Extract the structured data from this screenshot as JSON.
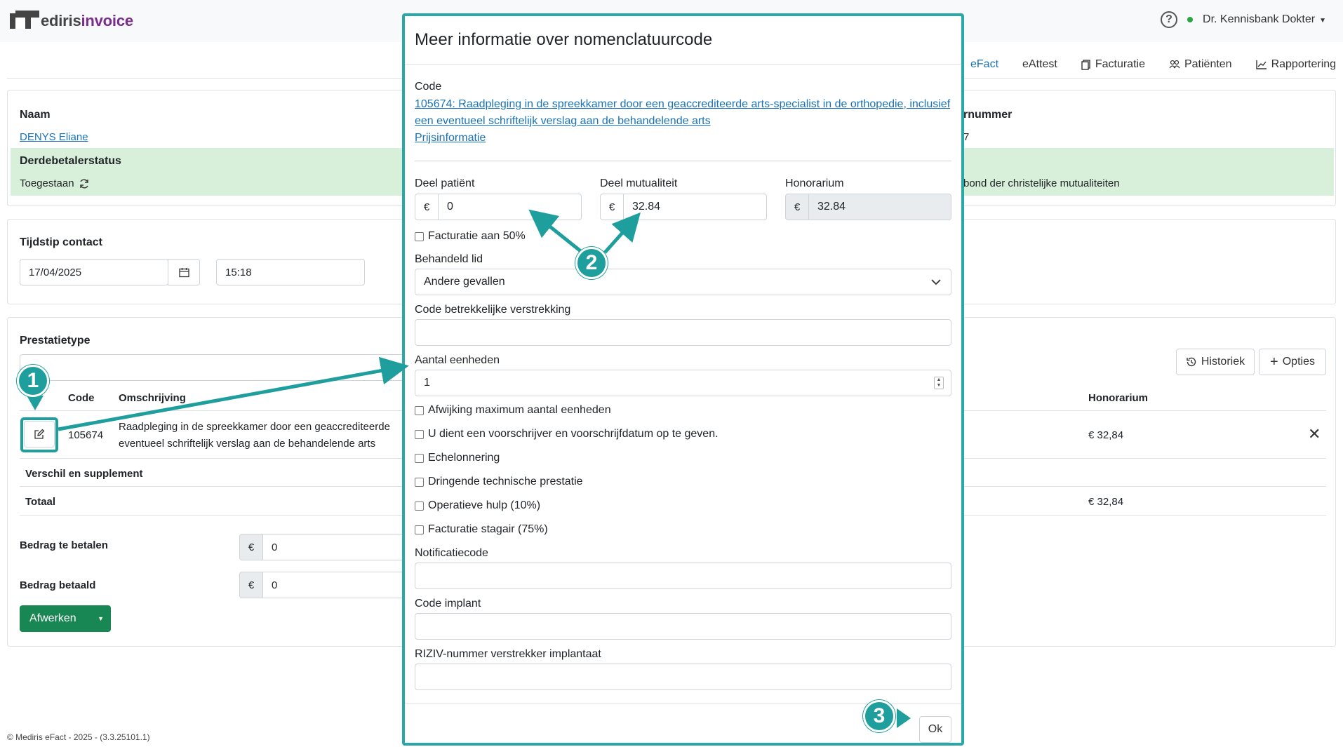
{
  "app": {
    "logo_prefix": "m",
    "logo_main": "ediris",
    "logo_accent": "invoice",
    "user": "Dr. Kennisbank Dokter"
  },
  "nav": {
    "tabs": [
      "eFact",
      "eAttest",
      "Facturatie",
      "Patiënten",
      "Rapportering"
    ]
  },
  "patient": {
    "name_label": "Naam",
    "name": "DENYS Eliane",
    "status_label": "Derdebetalerstatus",
    "status": "Toegestaan",
    "number_label": "rnummer",
    "number_value": "7",
    "mutuality": "bond der christelijke mutualiteiten"
  },
  "contact": {
    "label": "Tijdstip contact",
    "date": "17/04/2025",
    "time": "15:18"
  },
  "prestatie": {
    "label": "Prestatietype",
    "history_label": "Historiek",
    "options_label": "Opties",
    "col_code": "Code",
    "col_desc": "Omschrijving",
    "col_honor": "Honorarium",
    "row": {
      "code": "105674",
      "desc_line1": "Raadpleging in de spreekkamer door een geaccrediteerde",
      "desc_line2": "eventueel schriftelijk verslag aan de behandelende arts",
      "honor": "€ 32,84"
    },
    "diff_label": "Verschil en supplement",
    "total_label": "Totaal",
    "total_value": "€ 32,84",
    "to_pay_label": "Bedrag te betalen",
    "to_pay_value": "0",
    "paid_label": "Bedrag betaald",
    "paid_value": "0",
    "finish_label": "Afwerken",
    "currency": "€"
  },
  "modal": {
    "title": "Meer informatie over nomenclatuurcode",
    "code_label": "Code",
    "code_link_line1": "105674: Raadpleging in de spreekkamer door een geaccrediteerde arts-specialist in de orthopedie, inclusief",
    "code_link_line2": "een eventueel schriftelijk verslag aan de behandelende arts",
    "price_info": "Prijsinformatie",
    "deel_patient_label": "Deel patiënt",
    "deel_patient_value": "0",
    "deel_mut_label": "Deel mutualiteit",
    "deel_mut_value": "32.84",
    "honor_label": "Honorarium",
    "honor_value": "32.84",
    "currency": "€",
    "fact50": "Facturatie aan 50%",
    "behandeld_label": "Behandeld lid",
    "behandeld_value": "Andere gevallen",
    "code_verstrekking_label": "Code betrekkelijke verstrekking",
    "aantal_label": "Aantal eenheden",
    "aantal_value": "1",
    "checks": [
      "Afwijking maximum aantal eenheden",
      "U dient een voorschrijver en voorschrijfdatum op te geven.",
      "Echelonnering",
      "Dringende technische prestatie",
      "Operatieve hulp (10%)",
      "Facturatie stagair (75%)"
    ],
    "notif_label": "Notificatiecode",
    "implant_label": "Code implant",
    "riziv_label": "RIZIV-nummer verstrekker implantaat",
    "ok_label": "Ok"
  },
  "annotations": [
    "1",
    "2",
    "3"
  ],
  "colors": {
    "accent": "#2aa8a8",
    "link": "#1a73b8",
    "success": "#198754",
    "status_bg": "#d8efd9"
  },
  "footer": "© Mediris eFact - 2025 - (3.3.25101.1)"
}
